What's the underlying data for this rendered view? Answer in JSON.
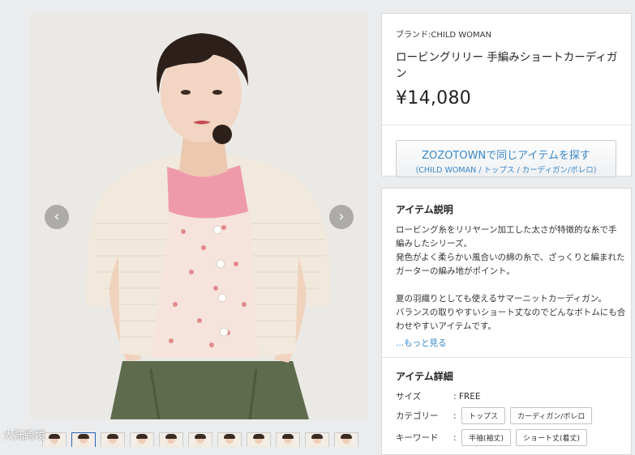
{
  "gallery": {
    "prev_arrow": "‹",
    "next_arrow": "›",
    "thumbnail_count": 11,
    "active_thumbnail": 2
  },
  "product": {
    "brand_label": "ブランド:CHILD WOMAN",
    "name": "ロービングリリー 手編みショートカーディガン",
    "price": "¥14,080"
  },
  "zozo_button": {
    "main": "ZOZOTOWNで同じアイテムを探す",
    "sub": "(CHILD WOMAN / トップス / カーディガン/ボレロ)"
  },
  "description": {
    "title": "アイテム説明",
    "lines": [
      "ロービング糸をリリヤーン加工した太さが特徴的な糸で手",
      "編みしたシリーズ。",
      "発色がよく柔らかい風合いの綿の糸で、ざっくりと編まれた",
      "ガーターの編み地がポイント。",
      "",
      "夏の羽織りとしても使えるサマーニットカーディガン。",
      "バランスの取りやすいショート丈なのでどんなボトムにも合",
      "わせやすいアイテムです。"
    ],
    "more_link": "...もっと見る"
  },
  "details": {
    "title": "アイテム詳細",
    "size_label": "サイズ",
    "size_value": ": FREE",
    "category_label": "カテゴリー",
    "category_sep": ":",
    "category_tags": [
      "トップス",
      "カーディガン/ボレロ"
    ],
    "keyword_label": "キーワード",
    "keyword_sep": ":",
    "keyword_tags": [
      "半袖(袖丈)",
      "ショート丈(着丈)"
    ]
  },
  "watermark": "大陆跨境",
  "colors": {
    "link": "#3a88c8",
    "active_border": "#2b63b9",
    "page_bg": "#ebecee"
  }
}
